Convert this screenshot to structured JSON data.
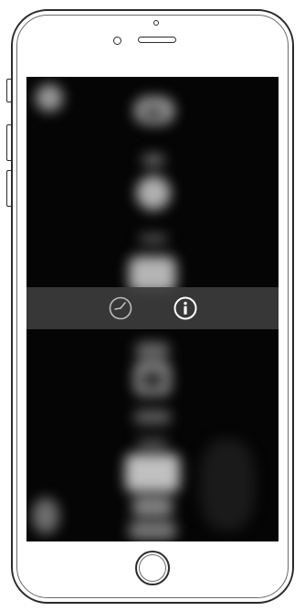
{
  "device": {
    "frame_color": "#2b2b2b",
    "screen_color": "#050505"
  },
  "toolbar": {
    "background": "#3c3c3c",
    "icons": [
      {
        "name": "clock-icon",
        "color": "#bdbdbd"
      },
      {
        "name": "info-icon",
        "color": "#ffffff"
      }
    ]
  }
}
